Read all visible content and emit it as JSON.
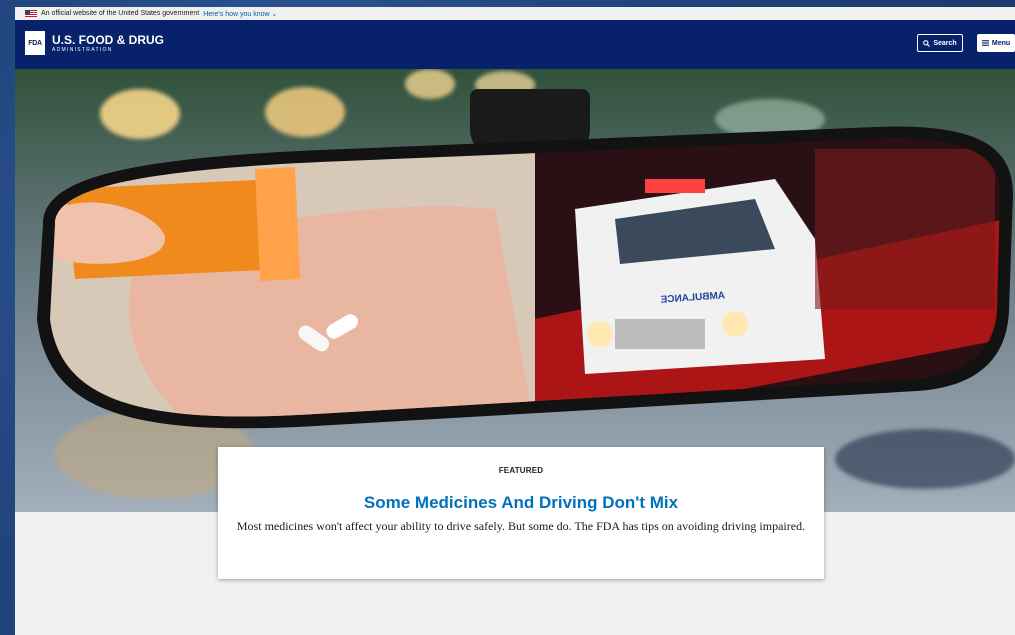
{
  "gov_banner": {
    "text": "An official website of the United States government",
    "link": "Here's how you know ⌄"
  },
  "header": {
    "logo_mark": "FDA",
    "logo_title": "U.S. FOOD & DRUG",
    "logo_subtitle": "ADMINISTRATION",
    "search_label": "Search",
    "menu_label": "Menu"
  },
  "hero": {
    "ambulance_text": "AMBULANCE"
  },
  "featured": {
    "kicker": "FEATURED",
    "title": "Some Medicines And Driving Don't Mix",
    "description": "Most medicines won't affect your ability to drive safely. But some do. The FDA has tips on avoiding driving impaired."
  },
  "colors": {
    "header_bg": "#07216b",
    "title_blue": "#0071bb"
  }
}
